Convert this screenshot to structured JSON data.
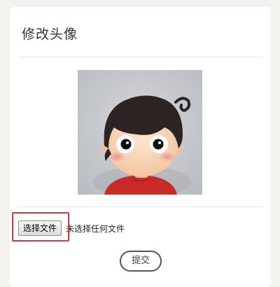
{
  "page": {
    "title": "修改头像"
  },
  "avatar": {
    "icon": "cartoon-avatar-image",
    "background_color": "#c3c6cc"
  },
  "file_input": {
    "button_label": "选择文件",
    "status_text": "未选择任何文件"
  },
  "annotation": {
    "highlight_color": "#d9363e"
  },
  "form": {
    "submit_label": "提交"
  }
}
